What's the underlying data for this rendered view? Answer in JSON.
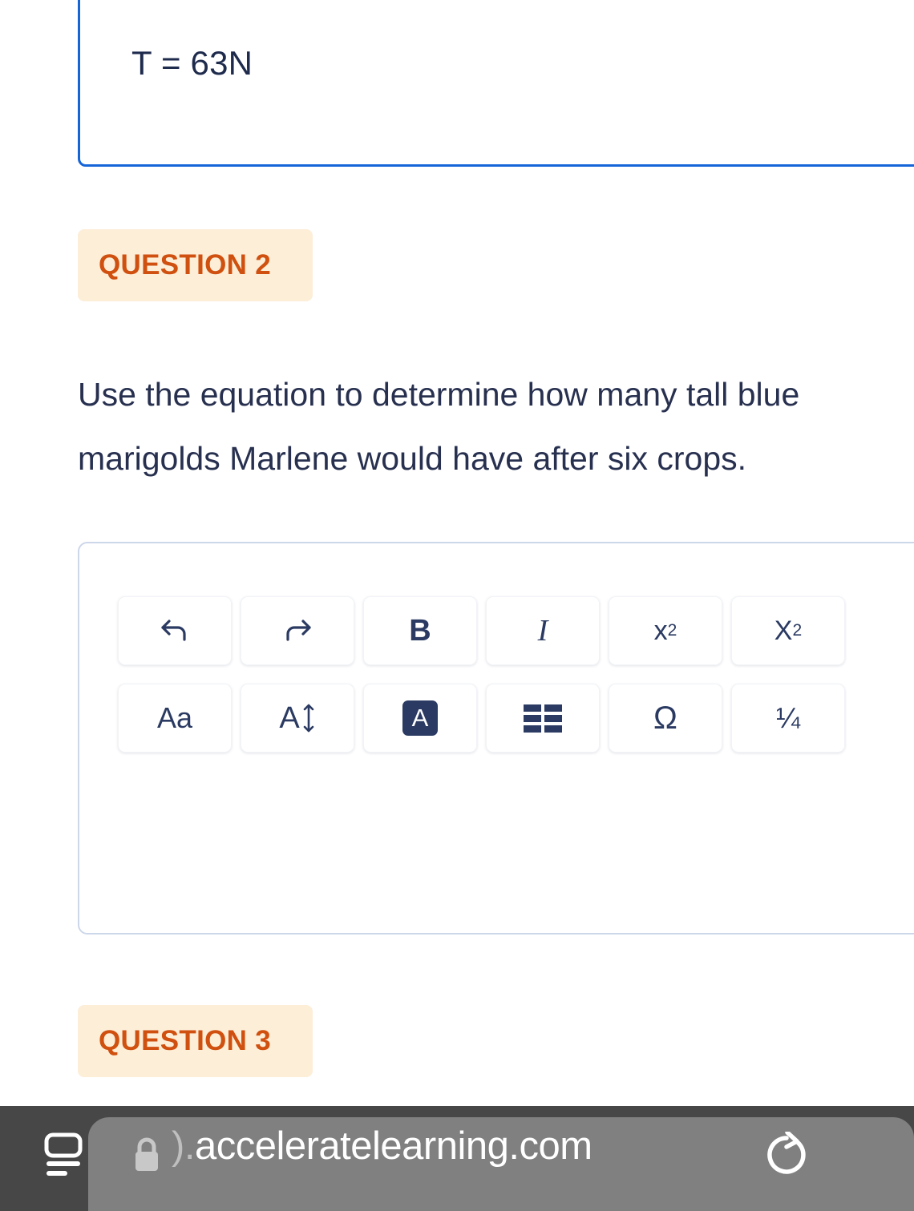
{
  "answer_box_1": {
    "value": "T = 63N",
    "border_color": "#1565d8",
    "state": "focused"
  },
  "question_2": {
    "badge_label": "QUESTION 2",
    "badge_bg": "#fdeed8",
    "badge_text_color": "#d0500f",
    "prompt_line_1": "Use the equation to determine how many tall blue",
    "prompt_line_2": "marigolds Marlene would have after six crops.",
    "prompt_color": "#27304f"
  },
  "question_3": {
    "badge_label": "QUESTION 3"
  },
  "editor": {
    "border_color": "#ccd7ea",
    "value": "",
    "toolbar": {
      "row_1": [
        {
          "name": "undo",
          "label": ""
        },
        {
          "name": "redo",
          "label": ""
        },
        {
          "name": "bold",
          "label": "B"
        },
        {
          "name": "italic",
          "label": "I"
        },
        {
          "name": "superscript",
          "base": "x",
          "exp": "2"
        },
        {
          "name": "subscript",
          "base": "X",
          "sub": "2"
        }
      ],
      "row_2": [
        {
          "name": "font-family",
          "label": "Aa"
        },
        {
          "name": "font-size",
          "label": "A"
        },
        {
          "name": "text-color",
          "label": "A"
        },
        {
          "name": "insert-table",
          "label": ""
        },
        {
          "name": "special-characters",
          "label": "Ω"
        },
        {
          "name": "fraction",
          "label": "¼"
        }
      ]
    }
  },
  "browser": {
    "url_prefix": ").",
    "url": "acceleratelearning.com",
    "bar_bg": "#474747",
    "pill_bg": "#808080"
  }
}
